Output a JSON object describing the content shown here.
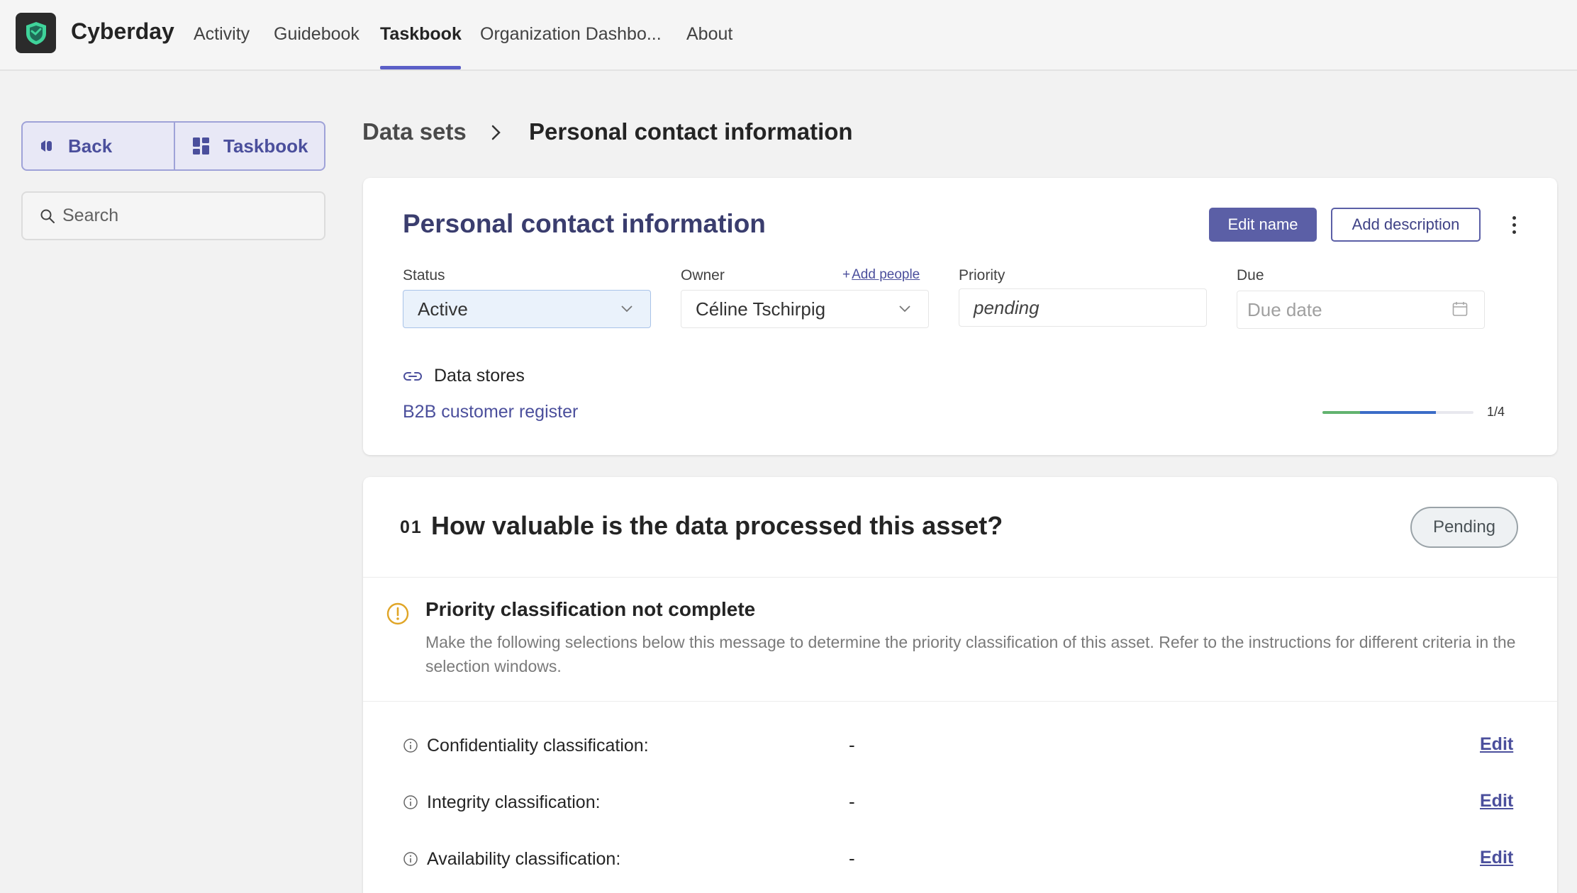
{
  "app": {
    "name": "Cyberday"
  },
  "nav": {
    "tabs": [
      {
        "label": "Activity"
      },
      {
        "label": "Guidebook"
      },
      {
        "label": "Taskbook"
      },
      {
        "label": "Organization Dashbo..."
      },
      {
        "label": "About"
      }
    ],
    "active_tab": "Taskbook"
  },
  "sidebar": {
    "back_label": "Back",
    "taskbook_label": "Taskbook",
    "search_placeholder": "Search"
  },
  "breadcrumb": {
    "parent": "Data sets",
    "current": "Personal contact information"
  },
  "asset": {
    "title": "Personal contact information",
    "edit_name_label": "Edit name",
    "add_description_label": "Add description",
    "status_label": "Status",
    "status_value": "Active",
    "owner_label": "Owner",
    "add_people_label": "Add people",
    "owner_value": "Céline Tschirpig",
    "priority_label": "Priority",
    "priority_value": "pending",
    "due_label": "Due",
    "due_placeholder": "Due date",
    "data_stores_label": "Data stores",
    "data_store_link": "B2B customer register",
    "progress_label": "1/4",
    "progress_fraction": 0.75
  },
  "question": {
    "number": "01",
    "title": "How valuable is the data processed this asset?",
    "status_badge": "Pending",
    "warning_title": "Priority classification not complete",
    "warning_text": "Make the following selections below this message to determine the priority classification of this asset. Refer to the instructions for different criteria in the selection windows.",
    "classifications": [
      {
        "label": "Confidentiality classification:",
        "value": "-",
        "edit": "Edit"
      },
      {
        "label": "Integrity classification:",
        "value": "-",
        "edit": "Edit"
      },
      {
        "label": "Availability classification:",
        "value": "-",
        "edit": "Edit"
      }
    ]
  },
  "colors": {
    "accent": "#5b5fa6",
    "link": "#4b4f9c",
    "warning": "#e0a526",
    "progress_green": "#62b36f",
    "progress_blue": "#3b6cc7"
  }
}
